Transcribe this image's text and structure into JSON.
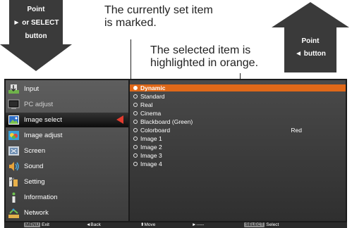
{
  "callouts": {
    "down_arrow": {
      "line1": "Point",
      "line2": "► or SELECT",
      "line3": "button"
    },
    "up_arrow": {
      "line1": "Point",
      "line2": "◄  button"
    },
    "annotation_top": {
      "line1": "The currently set item",
      "line2": "is marked."
    },
    "annotation_mid": {
      "line1": "The selected item is",
      "line2": "highlighted in orange."
    }
  },
  "menu": {
    "items": [
      {
        "label": "Input",
        "icon": "input-icon"
      },
      {
        "label": "PC adjust",
        "icon": "pc-adjust-icon"
      },
      {
        "label": "Image select",
        "icon": "image-select-icon",
        "selected": true
      },
      {
        "label": "Image adjust",
        "icon": "image-adjust-icon"
      },
      {
        "label": "Screen",
        "icon": "screen-icon"
      },
      {
        "label": "Sound",
        "icon": "sound-icon"
      },
      {
        "label": "Setting",
        "icon": "setting-icon"
      },
      {
        "label": "Information",
        "icon": "information-icon"
      },
      {
        "label": "Network",
        "icon": "network-icon"
      }
    ]
  },
  "submenu": {
    "items": [
      {
        "label": "Dynamic",
        "value": "",
        "selected": true
      },
      {
        "label": "Standard",
        "value": ""
      },
      {
        "label": "Real",
        "value": ""
      },
      {
        "label": "Cinema",
        "value": ""
      },
      {
        "label": "Blackboard (Green)",
        "value": ""
      },
      {
        "label": "Colorboard",
        "value": "Red"
      },
      {
        "label": "Image 1",
        "value": ""
      },
      {
        "label": "Image 2",
        "value": ""
      },
      {
        "label": "Image 3",
        "value": ""
      },
      {
        "label": "Image 4",
        "value": ""
      }
    ]
  },
  "statusbar": {
    "exit_key": "MENU",
    "exit_label": "Exit",
    "back_label": "◄Back",
    "move_label": "⬍Move",
    "next_label": "►-----",
    "select_key": "SELECT",
    "select_label": "Select"
  },
  "colors": {
    "highlight": "#e06818",
    "pointer": "#e23b2e"
  }
}
